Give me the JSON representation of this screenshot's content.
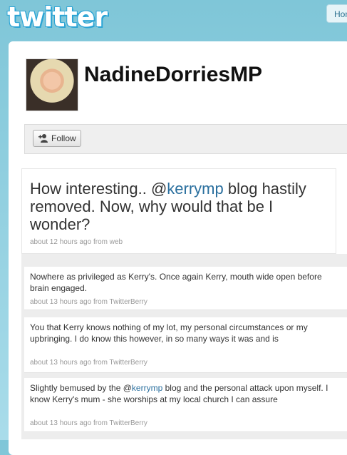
{
  "header": {
    "logo_text": "twitter",
    "home_label": "Hom"
  },
  "profile": {
    "username": "NadineDorriesMP",
    "follow_label": "Follow"
  },
  "featured": {
    "text_before": "How interesting.. @",
    "mention": "kerrymp",
    "text_after": " blog hastily removed. Now, why would that be I wonder?",
    "meta": "about 12 hours ago from web"
  },
  "tweets": [
    {
      "text": "Nowhere as privileged as Kerry's. Once again Kerry, mouth wide open before brain engaged.",
      "meta": "about 13 hours ago from TwitterBerry"
    },
    {
      "text": "You that Kerry knows nothing of my lot, my personal circumstances or my upbringing. I do know this however, in so many ways it was and is",
      "meta": "about 13 hours ago from TwitterBerry"
    },
    {
      "text_before": "Slightly bemused by the @",
      "mention": "kerrymp",
      "text_after": " blog and the personal attack upon myself. I know Kerry's mum - she worships at my local church I can assure",
      "meta": "about 13 hours ago from TwitterBerry"
    }
  ],
  "colors": {
    "link": "#2a6f9e",
    "background": "#8fd0e0"
  }
}
